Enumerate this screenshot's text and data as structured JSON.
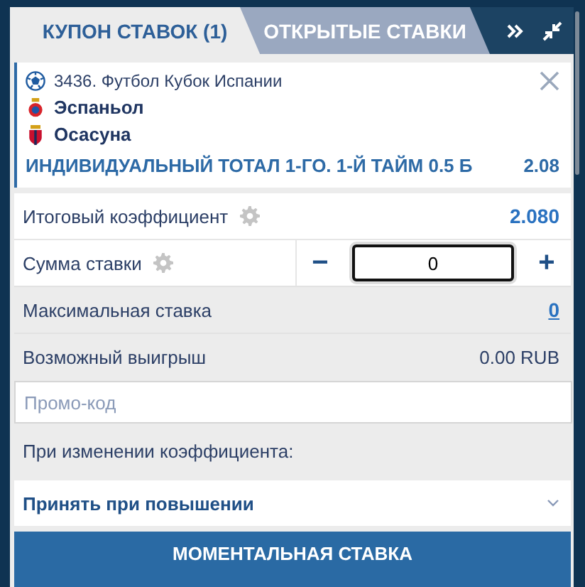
{
  "tabs": [
    {
      "label": "КУПОН СТАВОК (1)",
      "selected": true
    },
    {
      "label": "ОТКРЫТЫЕ СТАВКИ",
      "selected": false
    }
  ],
  "bet": {
    "event": "3436. Футбол Кубок Испании",
    "teams": [
      "Эспаньол",
      "Осасуна"
    ],
    "market": "ИНДИВИДУАЛЬНЫЙ ТОТАЛ 1-ГО. 1-Й ТАЙМ 0.5 Б",
    "odds": "2.08"
  },
  "total_odds": {
    "label": "Итоговый коэффициент",
    "value": "2.080"
  },
  "stake": {
    "label": "Сумма ставки",
    "minus": "−",
    "value": "0",
    "plus": "+"
  },
  "max_stake": {
    "label": "Максимальная ставка",
    "value": "0"
  },
  "possible_win": {
    "label": "Возможный выигрыш",
    "value": "0.00 RUB"
  },
  "promo": {
    "placeholder": "Промо-код"
  },
  "odds_change": {
    "label": "При изменении коэффициента:",
    "value": "Принять при повышении"
  },
  "submit": "МОМЕНТАЛЬНАЯ СТАВКА"
}
